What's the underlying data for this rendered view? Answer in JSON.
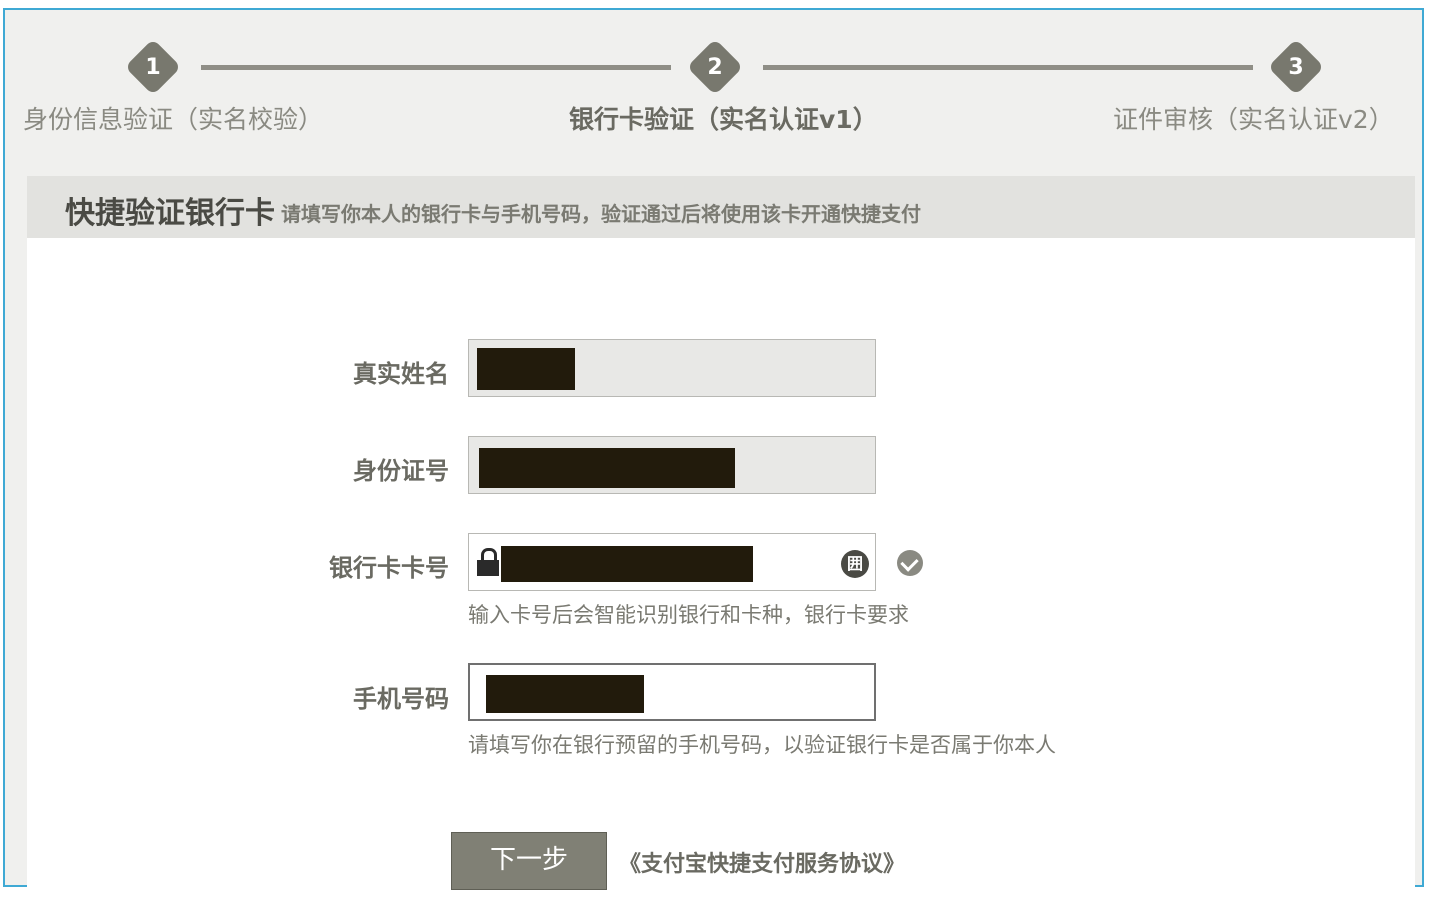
{
  "stepper": {
    "steps": [
      {
        "number": "1",
        "label": "身份信息验证（实名校验）"
      },
      {
        "number": "2",
        "label": "银行卡验证（实名认证v1）"
      },
      {
        "number": "3",
        "label": "证件审核（实名认证v2）"
      }
    ],
    "active_step": 2
  },
  "panel": {
    "title": "快捷验证银行卡",
    "subtitle": "请填写你本人的银行卡与手机号码，验证通过后将使用该卡开通快捷支付"
  },
  "form": {
    "real_name": {
      "label": "真实姓名",
      "value": ""
    },
    "id_number": {
      "label": "身份证号",
      "value": ""
    },
    "bank_card": {
      "label": "银行卡卡号",
      "value": "",
      "hint": "输入卡号后会智能识别银行和卡种，银行卡要求",
      "keyboard_icon_text": "囲"
    },
    "phone": {
      "label": "手机号码",
      "value": "",
      "hint": "请填写你在银行预留的手机号码，以验证银行卡是否属于你本人"
    }
  },
  "actions": {
    "next_label": "下一步",
    "agreement_label": "《支付宝快捷支付服务协议》"
  },
  "colors": {
    "accent_border": "#3fa9d4",
    "step_badge": "#78786e",
    "button": "#808075",
    "redaction": "#221b0c"
  }
}
